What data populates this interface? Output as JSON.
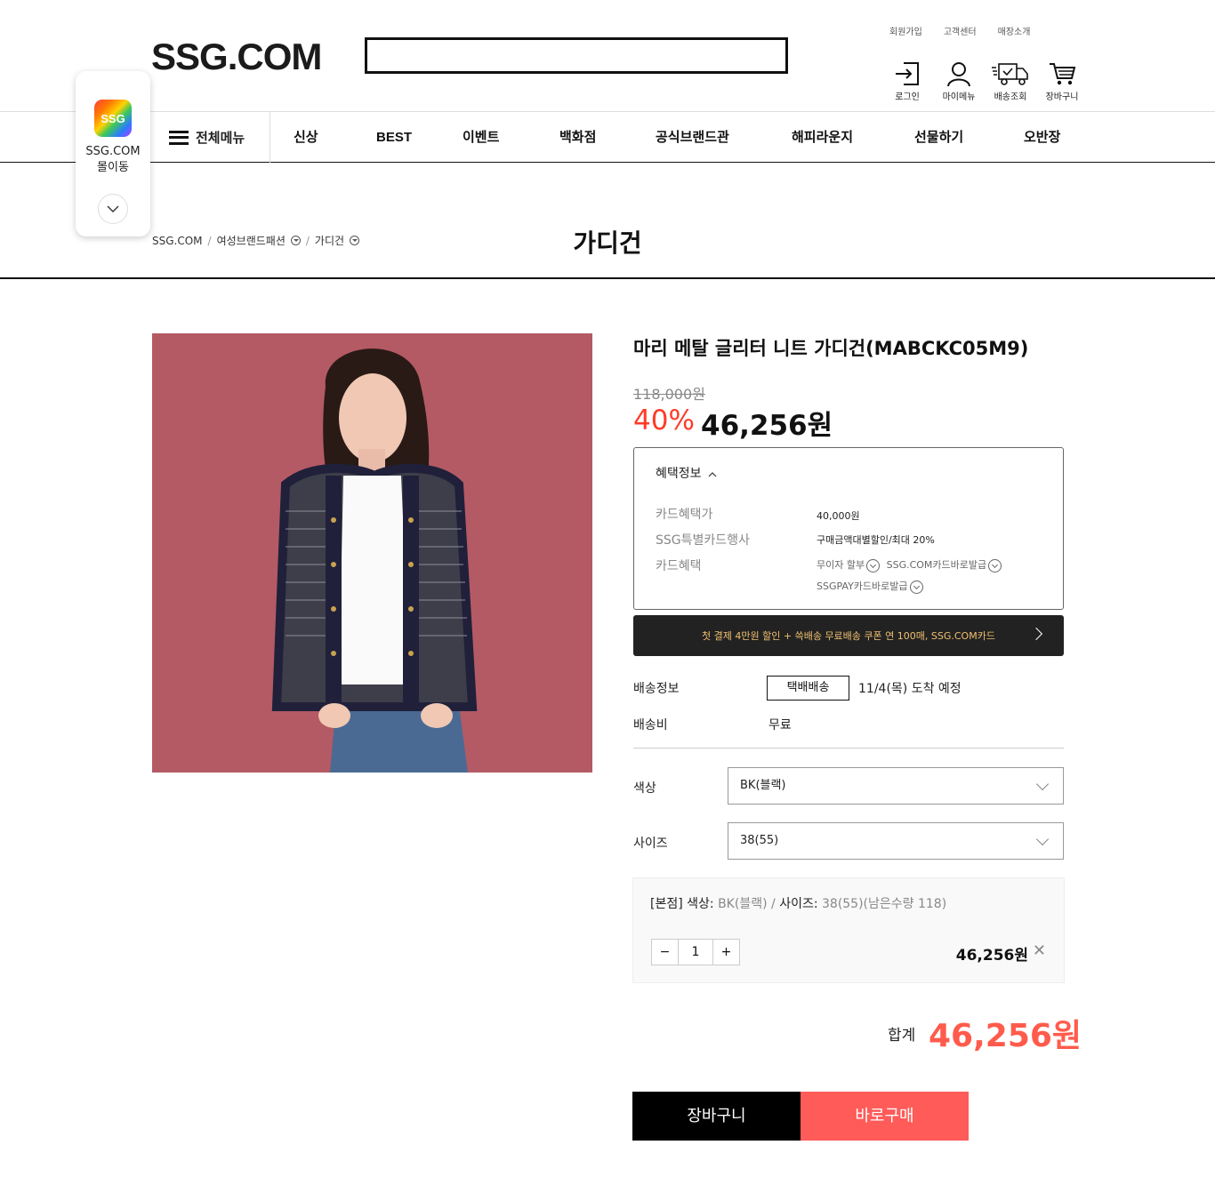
{
  "header": {
    "logo": "SSG.COM",
    "search_placeholder": "",
    "util_links": [
      "회원가입",
      "고객센터",
      "매장소개"
    ],
    "util_icons": [
      {
        "label": "로그인",
        "icon": "login-icon"
      },
      {
        "label": "마이메뉴",
        "icon": "user-icon"
      },
      {
        "label": "배송조회",
        "icon": "delivery-truck-icon"
      },
      {
        "label": "장바구니",
        "icon": "cart-icon"
      }
    ]
  },
  "nav": {
    "all_menu": "전체메뉴",
    "items": [
      "신상",
      "BEST",
      "이벤트",
      "백화점",
      "공식브랜드관",
      "해피라운지",
      "선물하기",
      "오반장"
    ]
  },
  "float_app": {
    "icon_text": "SSG",
    "label_line1": "SSG.COM",
    "label_line2": "몰이동"
  },
  "breadcrumb": {
    "root": "SSG.COM",
    "level1": "여성브랜드패션",
    "level2": "가디건"
  },
  "category_title": "가디건",
  "product": {
    "title": "마리 메탈 글리터 니트 가디건(MABCKC05M9)",
    "original_price": "118,000원",
    "discount": "40%",
    "sale_price": "46,256원"
  },
  "benefit": {
    "header": "혜택정보",
    "rows": [
      {
        "label": "카드혜택가",
        "value": "40,000원"
      },
      {
        "label": "SSG특별카드행사",
        "value": "구매금액대별할인/최대 20%"
      },
      {
        "label": "카드혜택",
        "links": [
          "무이자 할부",
          "SSG.COM카드바로발급",
          "SSGPAY카드바로발급"
        ]
      }
    ]
  },
  "promo_text": "첫 결제 4만원 할인 + 쓱배송 무료배송 쿠폰 연 100매, SSG.COM카드",
  "shipping": {
    "label": "배송정보",
    "type": "택배배송",
    "date": "11/4(목) 도착 예정",
    "fee_label": "배송비",
    "fee": "무료"
  },
  "options": {
    "color_label": "색상",
    "color_value": "BK(블랙)",
    "size_label": "사이즈",
    "size_value": "38(55)"
  },
  "selected": {
    "store": "[본점]",
    "color_key": "색상:",
    "color_val": "BK(블랙)",
    "slash": "/",
    "size_key": "사이즈:",
    "size_val": "38(55)(남은수량 118)",
    "qty_minus": "−",
    "qty": "1",
    "qty_plus": "+",
    "price": "46,256원",
    "remove": "✕"
  },
  "total": {
    "label": "합계",
    "price": "46,256원"
  },
  "buttons": {
    "cart": "장바구니",
    "buy": "바로구매"
  }
}
